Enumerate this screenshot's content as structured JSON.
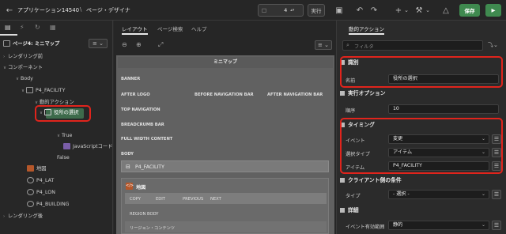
{
  "app": {
    "title": "アプリケーション14540",
    "breadcrumb": "ページ・デザイナ",
    "page_number": "4"
  },
  "toolbar": {
    "run_label": "実行",
    "save_label": "保存",
    "plus_label": "+",
    "chevron": "⌄"
  },
  "left": {
    "page_node": "ページ4: ミニマップ",
    "tree": {
      "pre_render": "レンダリング前",
      "components": "コンポーネント",
      "body": "Body",
      "facility": "P4_FACILITY",
      "dynamic_action": "動的アクション",
      "selected_action": "役所の選択",
      "true": "True",
      "javascript": "JavaScriptコード",
      "false": "False",
      "map": "地図",
      "lat": "P4_LAT",
      "lon": "P4_LON",
      "building": "P4_BUILDING",
      "post_render": "レンダリング後"
    }
  },
  "center": {
    "tabs": [
      "レイアウト",
      "ページ検索",
      "ヘルプ"
    ],
    "minimap_title": "ミニマップ",
    "banner": "BANNER",
    "after_logo": "AFTER LOGO",
    "before_nav": "BEFORE NAVIGATION BAR",
    "after_nav": "AFTER NAVIGATION BAR",
    "top_nav": "TOP NAVIGATION",
    "breadcrumb_bar": "BREADCRUMB BAR",
    "full_width": "FULL WIDTH CONTENT",
    "body": "BODY",
    "facility_item": "P4_FACILITY",
    "map_region": "地図",
    "buttons": [
      "COPY",
      "EDIT",
      "PREVIOUS",
      "NEXT"
    ],
    "region_body": "REGION BODY",
    "region_content": "リージョン・コンテンツ"
  },
  "right": {
    "tab": "動的アクション",
    "filter_placeholder": "フィルタ",
    "sections": {
      "identification": "識別",
      "execution": "実行オプション",
      "timing": "タイミング",
      "client_condition": "クライアント側の条件",
      "details": "詳細"
    },
    "props": {
      "name_label": "名前",
      "name_value": "役所の選択",
      "order_label": "順序",
      "order_value": "10",
      "event_label": "イベント",
      "event_value": "変更",
      "selection_type_label": "選択タイプ",
      "selection_type_value": "アイテム",
      "item_label": "アイテム",
      "item_value": "P4_FACILITY",
      "type_label": "タイプ",
      "type_value": "- 選択 -",
      "event_scope_label": "イベント有効範囲",
      "event_scope_value": "静的"
    }
  },
  "colors": {
    "accent_red": "#e0241c",
    "save_green": "#3f8a4f",
    "selected_node": "#3d6b4b"
  }
}
